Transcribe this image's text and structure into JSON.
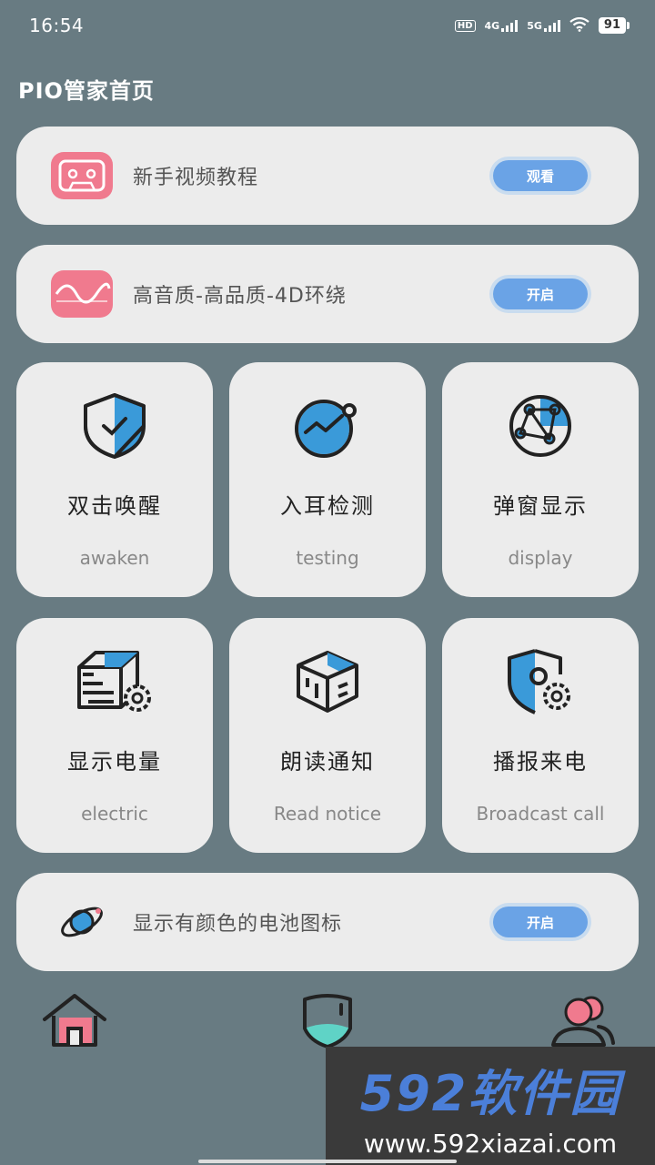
{
  "status_bar": {
    "time": "16:54",
    "hd": "HD",
    "net1": "4G",
    "net2": "5G",
    "battery": "91"
  },
  "page": {
    "title": "PIO管家首页"
  },
  "rows": {
    "tutorial": {
      "label": "新手视频教程",
      "button": "观看"
    },
    "audio": {
      "label": "高音质-高品质-4D环绕",
      "button": "开启"
    },
    "battery_icon": {
      "label": "显示有颜色的电池图标",
      "button": "开启"
    }
  },
  "tiles": [
    {
      "title": "双击唤醒",
      "subtitle": "awaken",
      "icon": "shield-check-icon"
    },
    {
      "title": "入耳检测",
      "subtitle": "testing",
      "icon": "trend-circle-icon"
    },
    {
      "title": "弹窗显示",
      "subtitle": "display",
      "icon": "network-globe-icon"
    },
    {
      "title": "显示电量",
      "subtitle": "electric",
      "icon": "box-gear-icon"
    },
    {
      "title": "朗读通知",
      "subtitle": "Read notice",
      "icon": "cube-icon"
    },
    {
      "title": "播报来电",
      "subtitle": "Broadcast call",
      "icon": "shield-gear-icon"
    }
  ],
  "bottom_nav": {
    "items": [
      "home-icon",
      "shield-icon",
      "users-icon"
    ]
  },
  "watermark": {
    "logo": "592软件园",
    "url": "www.592xiazai.com"
  },
  "colors": {
    "background": "#687b82",
    "card": "#ececec",
    "accent": "#6aa3e6",
    "icon_blue": "#3a9ad9",
    "icon_pink": "#f07a8e"
  }
}
